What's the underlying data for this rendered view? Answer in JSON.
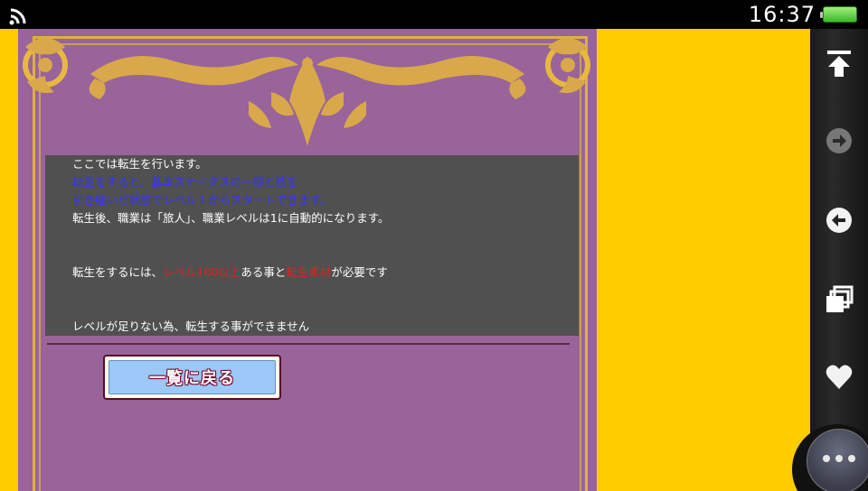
{
  "status_bar": {
    "time": "16:37",
    "wifi_icon": "wifi-signal-icon",
    "battery_icon": "battery-full-icon"
  },
  "rail": {
    "icons": [
      "scroll-top-icon",
      "forward-icon",
      "back-icon",
      "windows-icon",
      "favorite-heart-icon",
      "more-options-icon"
    ]
  },
  "info": {
    "line1": "ここでは転生を行います。",
    "line2": "転生をすると、基本ステータスの一部と技を",
    "line3": "引き継いだ状態でレベル１からスタートできます。",
    "line4": "転生後、職業は「旅人」、職業レベルは1に自動的になります。",
    "req_prefix": "転生をするには、",
    "req_level": "レベル100以上",
    "req_mid": "ある事と",
    "req_item": "転生素材",
    "req_suffix": "が必要です",
    "status_msg": "レベルが足りない為、転生する事ができません"
  },
  "buttons": {
    "back_label": "一覧に戻る"
  },
  "colors": {
    "background": "#ffcc00",
    "panel": "#98649a",
    "gold": "#e0b040",
    "infobox": "#505050",
    "highlight_blue": "#3333ff",
    "highlight_red": "#e02020",
    "button_fill": "#9cc8f8"
  }
}
